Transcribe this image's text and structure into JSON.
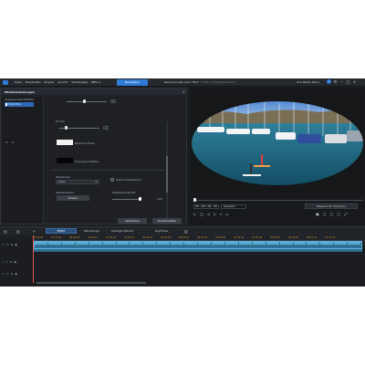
{
  "app": {
    "menu": [
      "Datei",
      "Bearbeiten",
      "Plugins",
      "Ansicht",
      "Wiedergabe",
      "Hilfe"
    ],
    "mode_button": "Bearbeiten",
    "project_title": "Neues Projekt ohne Titel*",
    "project_note": "(Fehlt: nicht gespeichert)",
    "account": "Ihre Marke Menü"
  },
  "effect_panel": {
    "title": "Effekteinstellungen",
    "list_label": "Angewendete Effekte",
    "list_item": "Vom Flim",
    "props": {
      "slider1_cap": "A",
      "intensity_label": "Dichte",
      "slider2_cap": "A",
      "frame_color_label": "Rahmen-Farbe",
      "bg_color_label": "Hintergrundfarbe",
      "mask_label": "Maskentyp",
      "mask_value": "Kreis",
      "auto_label": "Automatisierbar(?)",
      "export_label": "Maskentextur",
      "export_button": "Ändern",
      "opacity_label": "Maskendeckkraft",
      "opacity_value": "100"
    },
    "apply_button": "Abbrechen",
    "ok_button": "Zurücksetzen"
  },
  "preview": {
    "timecode": "00 ; 00 ; 00 ; 00",
    "view_select": "Sequenz",
    "zoom_label": "Passend für Vorschau"
  },
  "timeline": {
    "tab_active": "Effekt",
    "tools": [
      "Werkzeuge",
      "Anzeigen/Reduz.",
      "Keyframe"
    ],
    "ruler_marks": [
      "00:00:00",
      "00:00:04",
      "00:00:08",
      "00:00:12",
      "00:00:16",
      "00:00:20",
      "00:00:24",
      "00:00:28",
      "00:00:32",
      "00:00:36",
      "00:00:40",
      "00:00:44",
      "00:00:48",
      "00:00:52",
      "00:00:56",
      "00:01:00",
      "00:01:04"
    ],
    "track1_num": "1",
    "track2_num": "1",
    "track3_num": "2"
  },
  "colors": {
    "accent": "#2f7bd6",
    "clip": "#3d8fb8",
    "playhead": "#e05050"
  }
}
